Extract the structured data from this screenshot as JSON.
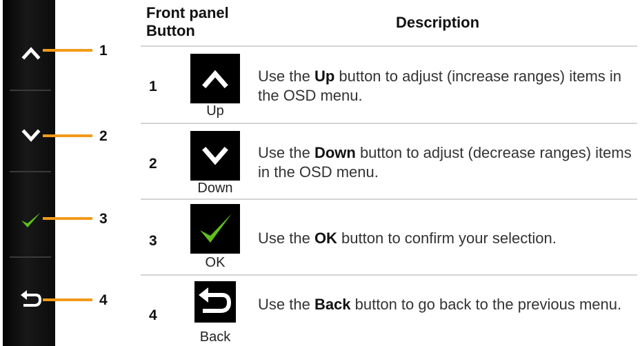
{
  "header": {
    "col1": "Front panel Button",
    "col2": "Description"
  },
  "callouts": [
    "1",
    "2",
    "3",
    "4"
  ],
  "rows": [
    {
      "number": "1",
      "icon": "up-arrow-icon",
      "label": "Up",
      "desc_pre": "Use the ",
      "desc_bold": "Up",
      "desc_post": " button to adjust (increase ranges) items in the OSD menu."
    },
    {
      "number": "2",
      "icon": "down-arrow-icon",
      "label": "Down",
      "desc_pre": "Use the ",
      "desc_bold": "Down",
      "desc_post": " button to adjust (decrease ranges) items in the OSD menu."
    },
    {
      "number": "3",
      "icon": "checkmark-icon",
      "label": "OK",
      "desc_pre": "Use the ",
      "desc_bold": "OK",
      "desc_post": " button to confirm your selection."
    },
    {
      "number": "4",
      "icon": "back-arrow-icon",
      "label": "Back",
      "desc_pre": "Use the ",
      "desc_bold": "Back",
      "desc_post": " button to go back to the previous menu."
    }
  ],
  "colors": {
    "leader": "#f29a1a",
    "check": "#5fbf1f",
    "panel": "#111111"
  }
}
